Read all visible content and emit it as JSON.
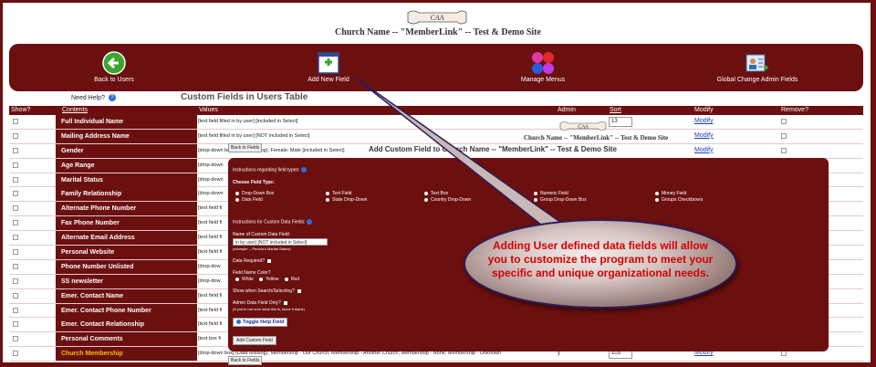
{
  "site_logo_text": "CAA",
  "site_title": "Church Name -- \"MemberLink\" -- Test & Demo Site",
  "toolbar": {
    "back_label": "Back to Users",
    "new_field_label": "Add New Field",
    "manage_menus_label": "Manage Menus",
    "global_change_label": "Global Change Admin Fields"
  },
  "need_help": "Need Help?",
  "page_heading": "Custom Fields in Users Table",
  "columns": {
    "show": "Show?",
    "contents": "Contents",
    "values": "Values",
    "admin": "Admin",
    "sort": "Sort",
    "modify": "Modify",
    "remove": "Remove?"
  },
  "rows": [
    {
      "name": "Full Individual Name",
      "value": "[text field filled in by user]  [included in Select]",
      "sort": "13",
      "modify": "Modify"
    },
    {
      "name": "Mailing Address Name",
      "value": "[text field filled in by user]  [NOT included in Select]",
      "sort": "",
      "modify": "Modify"
    },
    {
      "name": "Gender",
      "value": "[drop-down box] (Data Missing); Female; Male  [included in Select]",
      "sort": "",
      "modify": "Modify"
    },
    {
      "name": "Age Range",
      "value": "[drop-down",
      "sort": "",
      "modify": ""
    },
    {
      "name": "Marital Status",
      "value": "[drop-down",
      "sort": "",
      "modify": ""
    },
    {
      "name": "Family Relationship",
      "value": "[drop-down",
      "sort": "",
      "modify": ""
    },
    {
      "name": "Alternate Phone Number",
      "value": "[text field fi",
      "sort": "",
      "modify": ""
    },
    {
      "name": "Fax Phone Number",
      "value": "[text field fi",
      "sort": "",
      "modify": ""
    },
    {
      "name": "Alternate Email Address",
      "value": "[text field fi",
      "sort": "",
      "modify": ""
    },
    {
      "name": "Personal Website",
      "value": "[text field fi",
      "sort": "",
      "modify": ""
    },
    {
      "name": "Phone Number Unlisted",
      "value": "[drop-dow",
      "sort": "",
      "modify": ""
    },
    {
      "name": "SS newsletter",
      "value": "[drop-dow",
      "sort": "",
      "modify": ""
    },
    {
      "name": "Emer. Contact Name",
      "value": "[text field fi",
      "sort": "",
      "modify": ""
    },
    {
      "name": "Emer. Contact Phone Number",
      "value": "[text field fi",
      "sort": "",
      "modify": ""
    },
    {
      "name": "Emer. Contact Relationship",
      "value": "[text field fi",
      "sort": "",
      "modify": ""
    },
    {
      "name": "Personal Comments",
      "value": "[text box fi",
      "sort": "",
      "modify": ""
    },
    {
      "name": "Church Membership",
      "value": "[drop-down box] (Data Missing); Membership - Our Church; Membership - Another Church; Membership - None; Membership - Unknown",
      "admin": "y",
      "sort": "103",
      "modify": "Modify"
    }
  ],
  "overlay": {
    "logo_text": "CAA",
    "site_title": "Church Name -- \"MemberLink\" -- Test & Demo Site",
    "title": "Add Custom Field to Church Name -- \"MemberLink\" -- Test & Demo Site",
    "back_label": "Back to Fields",
    "instructions_field_types": "Instructions regarding field types:",
    "choose_type": "Choose Field Type:",
    "types": [
      "Drop-Down Box",
      "Text Field",
      "Text Box",
      "Numeric Field",
      "Money Field",
      "Date Field",
      "State Drop-Down",
      "Country Drop-Down",
      "Group Drop-Down Box",
      "Groups Checkboxes"
    ],
    "instructions_custom": "Instructions for Custom Data Fields:",
    "name_label": "Name of Custom Data Field:",
    "name_value": "in by user]  [NOT included in Select]",
    "name_example": "(example -- Person's Marital Status)",
    "required_label": "Data Required?",
    "color_label": "Field Name Color?",
    "colors": [
      "White",
      "Yellow",
      "Red"
    ],
    "show_label": "Show when Search/Selecting?",
    "admin_only_label": "Admin Data Field Only?",
    "admin_only_note": "(If you're not sure what this is, leave it blank)",
    "toggle_help": "Toggle Help Field",
    "add_button": "Add Custom Field"
  },
  "callout_text": "Adding User defined data fields will allow you to customize the program to meet your specific and unique organizational needs.",
  "colors": {
    "accent": "#6b0f0f",
    "link": "#1a3fb0",
    "callout_text": "#d40000"
  }
}
